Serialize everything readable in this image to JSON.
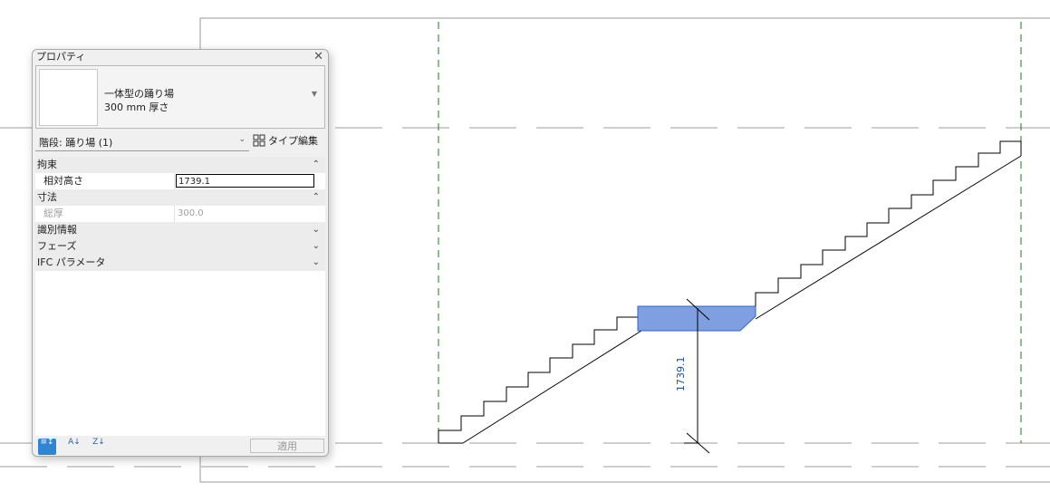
{
  "palette": {
    "title": "プロパティ",
    "close_glyph": "✕",
    "type_selector": {
      "name_line1": "一体型の踊り場",
      "name_line2": "300 mm 厚さ"
    },
    "instance_filter": "階段: 踊り場 (1)",
    "type_edit_label": "タイプ編集",
    "groups": [
      {
        "label": "拘束",
        "expanded": true
      },
      {
        "label": "寸法",
        "expanded": true
      },
      {
        "label": "識別情報",
        "expanded": false
      },
      {
        "label": "フェーズ",
        "expanded": false
      },
      {
        "label": "IFC パラメータ",
        "expanded": false
      }
    ],
    "params": {
      "relative_height": {
        "label": "相対高さ",
        "value": "1739.1"
      },
      "total_thickness": {
        "label": "総厚",
        "value": "300.0"
      }
    },
    "apply_label": "適用",
    "sort_buttons": [
      {
        "icon": "categorized-icon",
        "glyph": "≡↕"
      },
      {
        "icon": "sort-ascending-icon",
        "glyph": "A↓"
      },
      {
        "icon": "sort-descending-icon",
        "glyph": "Z↓"
      }
    ]
  },
  "drawing": {
    "dimension_text": "1739.1",
    "colors": {
      "landing_fill": "#7f9fe0",
      "landing_stroke": "#3366cc",
      "grid_line": "#1f7a1f",
      "dimension_text": "#1a4fa3",
      "level_line": "#9e9e9e"
    }
  }
}
